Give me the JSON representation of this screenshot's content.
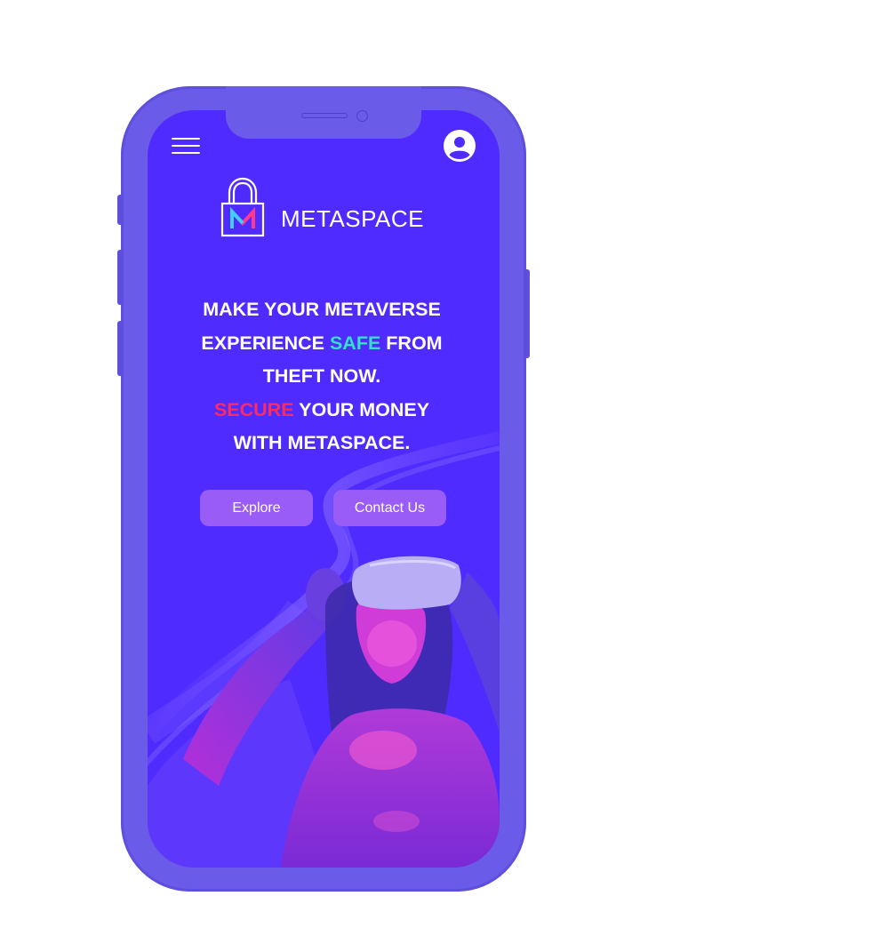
{
  "header": {
    "menu_icon": "hamburger-menu-icon",
    "profile_icon": "user-avatar-icon"
  },
  "brand": {
    "name": "METASPACE",
    "logo_letter": "M",
    "logo_icon": "padlock-icon"
  },
  "hero": {
    "line1": "MAKE YOUR METAVERSE",
    "line2_pre": "EXPERIENCE ",
    "line2_highlight": "SAFE",
    "line2_post": " FROM",
    "line3": "THEFT NOW.",
    "line4_highlight": "SECURE",
    "line4_post": " YOUR MONEY",
    "line5": "WITH METASPACE."
  },
  "buttons": {
    "explore_label": "Explore",
    "contact_label": "Contact Us"
  },
  "colors": {
    "screen_background": "#4f2bff",
    "phone_frame": "#6a5ce8",
    "button": "#9a5cf6",
    "safe_highlight": "#34e0c8",
    "secure_highlight": "#ff2a5f"
  }
}
